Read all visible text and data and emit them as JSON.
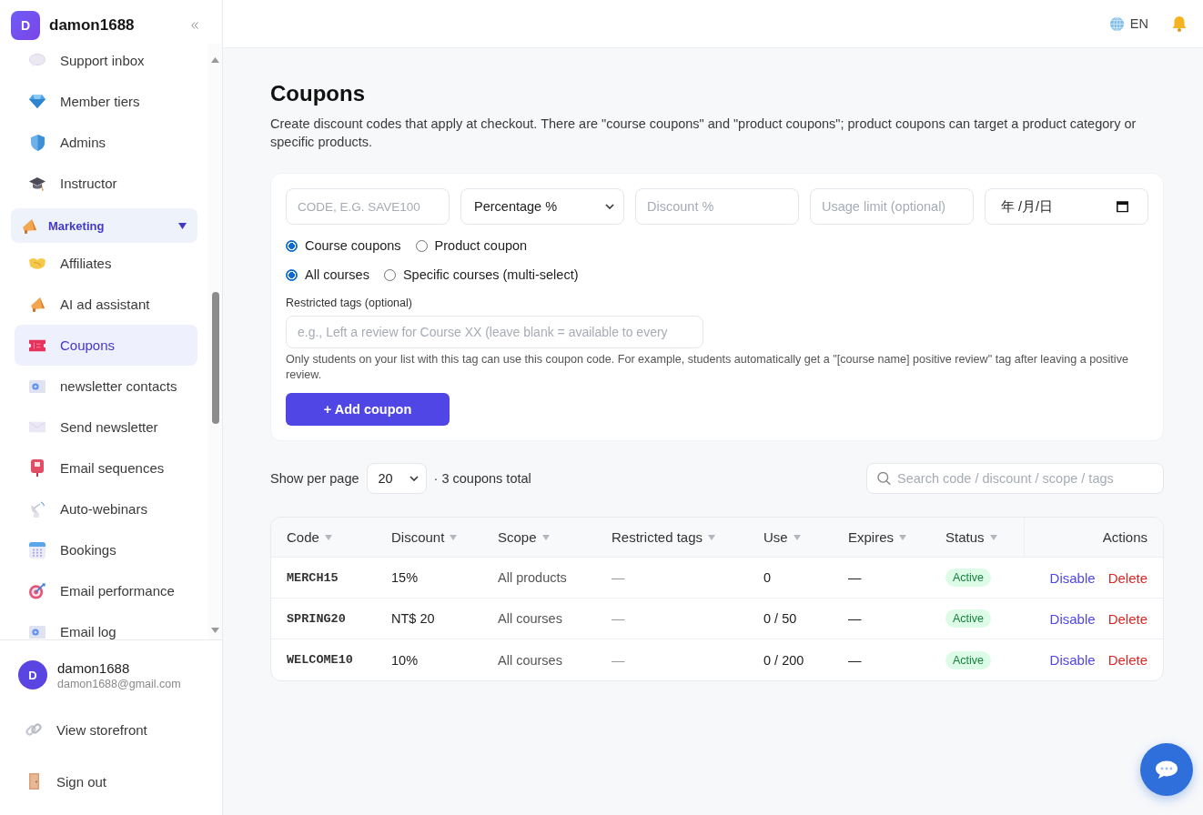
{
  "sidebar": {
    "brand": {
      "avatar_letter": "D",
      "name": "damon1688"
    },
    "nav_items": [
      {
        "kind": "link",
        "label": "Support inbox",
        "selected": false
      },
      {
        "kind": "link",
        "label": "Member tiers",
        "selected": false
      },
      {
        "kind": "link",
        "label": "Admins",
        "selected": false
      },
      {
        "kind": "link",
        "label": "Instructor",
        "selected": false
      },
      {
        "kind": "group",
        "label": "Marketing",
        "expanded": true,
        "children": [
          {
            "kind": "link",
            "label": "Affiliates",
            "selected": false
          },
          {
            "kind": "link",
            "label": "AI ad assistant",
            "selected": false
          },
          {
            "kind": "link",
            "label": "Coupons",
            "selected": true
          },
          {
            "kind": "link",
            "label": "newsletter contacts",
            "selected": false
          },
          {
            "kind": "link",
            "label": "Send newsletter",
            "selected": false
          },
          {
            "kind": "link",
            "label": "Email sequences",
            "selected": false
          },
          {
            "kind": "link",
            "label": "Auto-webinars",
            "selected": false
          },
          {
            "kind": "link",
            "label": "Bookings",
            "selected": false
          },
          {
            "kind": "link",
            "label": "Email performance",
            "selected": false
          },
          {
            "kind": "link",
            "label": "Email log",
            "selected": false
          }
        ]
      }
    ],
    "user": {
      "avatar_letter": "D",
      "name": "damon1688",
      "email": "damon1688@gmail.com"
    },
    "footer_links": [
      {
        "label": "View storefront"
      },
      {
        "label": "Sign out"
      }
    ]
  },
  "top_bar": {
    "language": "EN"
  },
  "page": {
    "title": "Coupons",
    "description": "Create discount codes that apply at checkout. There are \"course coupons\" and \"product coupons\"; product coupons can target a product category or specific products."
  },
  "coupon_form": {
    "code_field": {
      "placeholder": "CODE, E.G. SAVE100"
    },
    "discount_type": {
      "value": "Percentage %"
    },
    "discount_field": {
      "placeholder": "Discount %"
    },
    "usage_limit_field": {
      "placeholder": "Usage limit (optional)"
    },
    "expiry_date_field": {
      "placeholder": "年 /月/日"
    },
    "coupon_type_options": [
      {
        "label": "Course coupons",
        "selected": true
      },
      {
        "label": "Product coupon",
        "selected": false
      }
    ],
    "course_scope_options": [
      {
        "label": "All courses",
        "selected": true
      },
      {
        "label": "Specific courses (multi-select)",
        "selected": false
      }
    ],
    "restricted_tags": {
      "label": "Restricted tags (optional)",
      "placeholder": "e.g., Left a review for Course XX (leave blank = available to every",
      "help": "Only students on your list with this tag can use this coupon code. For example, students automatically get a \"[course name] positive review\" tag after leaving a positive review."
    },
    "submit_button": "+ Add coupon"
  },
  "list_toolbar": {
    "per_page_label": "Show per page",
    "per_page": "20",
    "total": "· 3 coupons total",
    "search": {
      "placeholder": "Search code / discount / scope / tags"
    }
  },
  "table": {
    "columns": [
      {
        "label": "Code",
        "sortable": true
      },
      {
        "label": "Discount",
        "sortable": true
      },
      {
        "label": "Scope",
        "sortable": true
      },
      {
        "label": "Restricted tags",
        "sortable": true
      },
      {
        "label": "Use",
        "sortable": true
      },
      {
        "label": "Expires",
        "sortable": true
      },
      {
        "label": "Status",
        "sortable": true
      },
      {
        "label": "Actions",
        "sortable": false
      }
    ],
    "rows": [
      {
        "code": "MERCH15",
        "discount": "15%",
        "scope": "All products",
        "restricted_tags": "—",
        "use": "0",
        "expires": "—",
        "status": {
          "label": "Active",
          "kind": "active"
        },
        "actions": [
          {
            "label": "Disable",
            "kind": "neutral"
          },
          {
            "label": "Delete",
            "kind": "danger"
          }
        ]
      },
      {
        "code": "SPRING20",
        "discount": "NT$ 20",
        "scope": "All courses",
        "restricted_tags": "—",
        "use": "0 / 50",
        "expires": "—",
        "status": {
          "label": "Active",
          "kind": "active"
        },
        "actions": [
          {
            "label": "Disable",
            "kind": "neutral"
          },
          {
            "label": "Delete",
            "kind": "danger"
          }
        ]
      },
      {
        "code": "WELCOME10",
        "discount": "10%",
        "scope": "All courses",
        "restricted_tags": "—",
        "use": "0 / 200",
        "expires": "—",
        "status": {
          "label": "Active",
          "kind": "active"
        },
        "actions": [
          {
            "label": "Disable",
            "kind": "neutral"
          },
          {
            "label": "Delete",
            "kind": "danger"
          }
        ]
      }
    ]
  }
}
